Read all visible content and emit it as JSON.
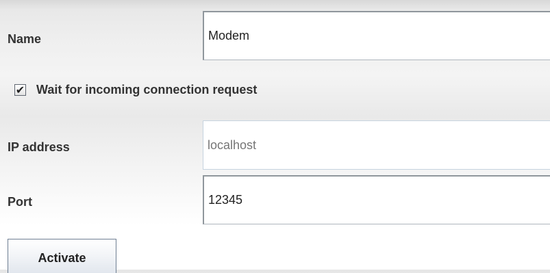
{
  "form": {
    "name": {
      "label": "Name",
      "value": "Modem"
    },
    "wait_checkbox": {
      "label": "Wait for incoming connection request",
      "checked": true,
      "check_glyph": "✔"
    },
    "ip_address": {
      "label": "IP address",
      "placeholder": "localhost",
      "enabled": false
    },
    "port": {
      "label": "Port",
      "value": "12345"
    },
    "activate_button": {
      "label": "Activate"
    }
  }
}
